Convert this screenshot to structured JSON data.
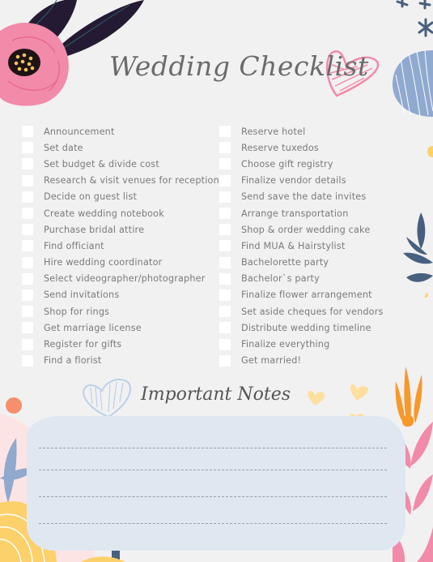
{
  "header": {
    "title": "Wedding Checklist"
  },
  "checklist": {
    "left": [
      {
        "label": "Announcement",
        "checked": false
      },
      {
        "label": "Set date",
        "checked": false
      },
      {
        "label": "Set budget & divide cost",
        "checked": false
      },
      {
        "label": "Research & visit venues for reception",
        "checked": false
      },
      {
        "label": "Decide on guest list",
        "checked": false
      },
      {
        "label": "Create wedding notebook",
        "checked": false
      },
      {
        "label": "Purchase bridal attire",
        "checked": false
      },
      {
        "label": "Find officiant",
        "checked": false
      },
      {
        "label": "Hire wedding coordinator",
        "checked": false
      },
      {
        "label": "Select videographer/photographer",
        "checked": false
      },
      {
        "label": "Send invitations",
        "checked": false
      },
      {
        "label": "Shop for rings",
        "checked": false
      },
      {
        "label": "Get marriage license",
        "checked": false
      },
      {
        "label": "Register for gifts",
        "checked": false
      },
      {
        "label": "Find a florist",
        "checked": false
      }
    ],
    "right": [
      {
        "label": "Reserve hotel",
        "checked": false
      },
      {
        "label": "Reserve tuxedos",
        "checked": false
      },
      {
        "label": "Choose gift registry",
        "checked": false
      },
      {
        "label": "Finalize vendor details",
        "checked": false
      },
      {
        "label": "Send save the date invites",
        "checked": false
      },
      {
        "label": "Arrange transportation",
        "checked": false
      },
      {
        "label": "Shop & order wedding cake",
        "checked": false
      },
      {
        "label": "Find MUA & Hairstylist",
        "checked": false
      },
      {
        "label": "Bachelorette party",
        "checked": false
      },
      {
        "label": "Bachelor`s party",
        "checked": false
      },
      {
        "label": "Finalize flower arrangement",
        "checked": false
      },
      {
        "label": "Set aside cheques for vendors",
        "checked": false
      },
      {
        "label": "Distribute wedding timeline",
        "checked": false
      },
      {
        "label": "Finalize everything",
        "checked": false
      },
      {
        "label": "Get married!",
        "checked": false
      }
    ]
  },
  "notes": {
    "title": "Important Notes",
    "lines": [
      "",
      "",
      "",
      ""
    ]
  },
  "colors": {
    "background": "#f1f1f1",
    "pink": "#f28aa9",
    "navy": "#241a33",
    "slate_blue": "#47607f",
    "light_blue": "#8fa9cf",
    "notes_fill": "#dfe8f1",
    "yellow": "#fcd06b",
    "orange": "#f7982b",
    "coral": "#f58f6c"
  }
}
